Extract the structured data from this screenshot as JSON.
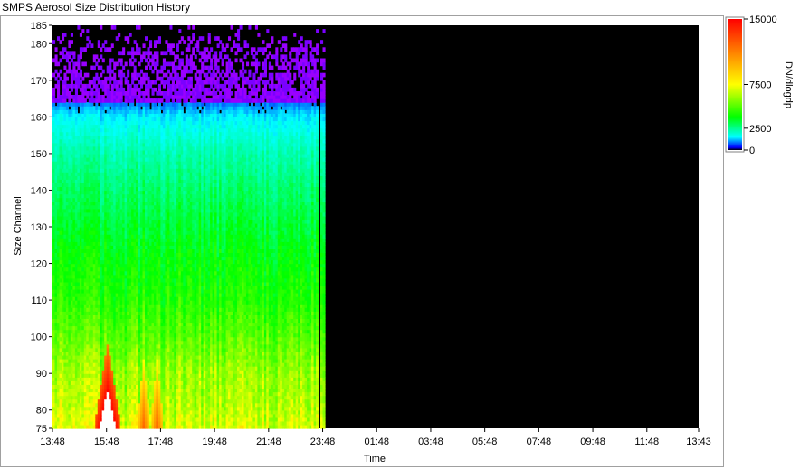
{
  "window": {
    "title": "SMPS Aerosol Size Distribution History"
  },
  "chart_data": {
    "type": "heatmap",
    "title": "SMPS Aerosol Size Distribution History",
    "xlabel": "Time",
    "ylabel": "Size Channel",
    "x_ticks": [
      "13:48",
      "15:48",
      "17:48",
      "19:48",
      "21:48",
      "23:48",
      "01:48",
      "03:48",
      "05:48",
      "07:48",
      "09:48",
      "11:48",
      "13:43"
    ],
    "y_ticks": [
      75,
      80,
      90,
      100,
      110,
      120,
      130,
      140,
      150,
      160,
      170,
      180,
      185
    ],
    "ylim": [
      75,
      185
    ],
    "data_extent": {
      "start": "13:48",
      "end": "23:48"
    },
    "gap_at": "23:38",
    "colorbar": {
      "label": "DN/dlogdp",
      "ticks": [
        15000,
        7500,
        2500,
        0
      ],
      "range": [
        0,
        15000
      ],
      "colors": [
        "#000000",
        "#0000ff",
        "#00ffff",
        "#00ff00",
        "#ffff00",
        "#ff8000",
        "#ff0000"
      ]
    },
    "profile": {
      "description_channels": [
        75,
        80,
        90,
        100,
        110,
        120,
        130,
        140,
        150,
        155,
        160,
        165,
        170,
        175,
        180,
        185
      ],
      "typical_values": [
        7000,
        6500,
        6000,
        5000,
        4200,
        3800,
        3300,
        2800,
        2200,
        1800,
        1400,
        600,
        300,
        120,
        40,
        10
      ]
    },
    "hotspots": [
      {
        "time": "15:48",
        "channel_max": 98,
        "level": "saturated"
      },
      {
        "time": "17:08",
        "channel_max": 94,
        "level": "high"
      },
      {
        "time": "17:38",
        "channel_max": 94,
        "level": "high"
      }
    ]
  }
}
